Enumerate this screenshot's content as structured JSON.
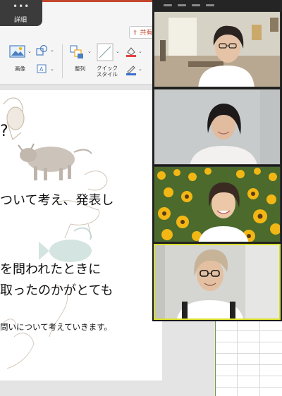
{
  "zoom_popup": {
    "dots": "•••",
    "label": "詳細"
  },
  "ribbon": {
    "share_label": "共有",
    "image_label": "画像",
    "arrange_label": "整列",
    "quick_style_line1": "クイック",
    "quick_style_line2": "スタイル",
    "textbox_glyph": "A"
  },
  "slide": {
    "line1": "?",
    "line2": "ついて考え、発表し",
    "line3": "を問われたときに",
    "line4": "取ったのかがとても",
    "line5": "問いについて考えていきます。"
  },
  "gallery": {
    "participants": [
      {
        "id": "participant-1",
        "scene": "living-room"
      },
      {
        "id": "participant-2",
        "scene": "plain-wall"
      },
      {
        "id": "participant-3",
        "scene": "sunflower-field"
      },
      {
        "id": "participant-4",
        "scene": "office",
        "active_speaker": true
      }
    ]
  },
  "colors": {
    "ppt_accent": "#c4472c",
    "active_speaker_border": "#d8df2a",
    "gallery_background": "#1b1b1b"
  }
}
